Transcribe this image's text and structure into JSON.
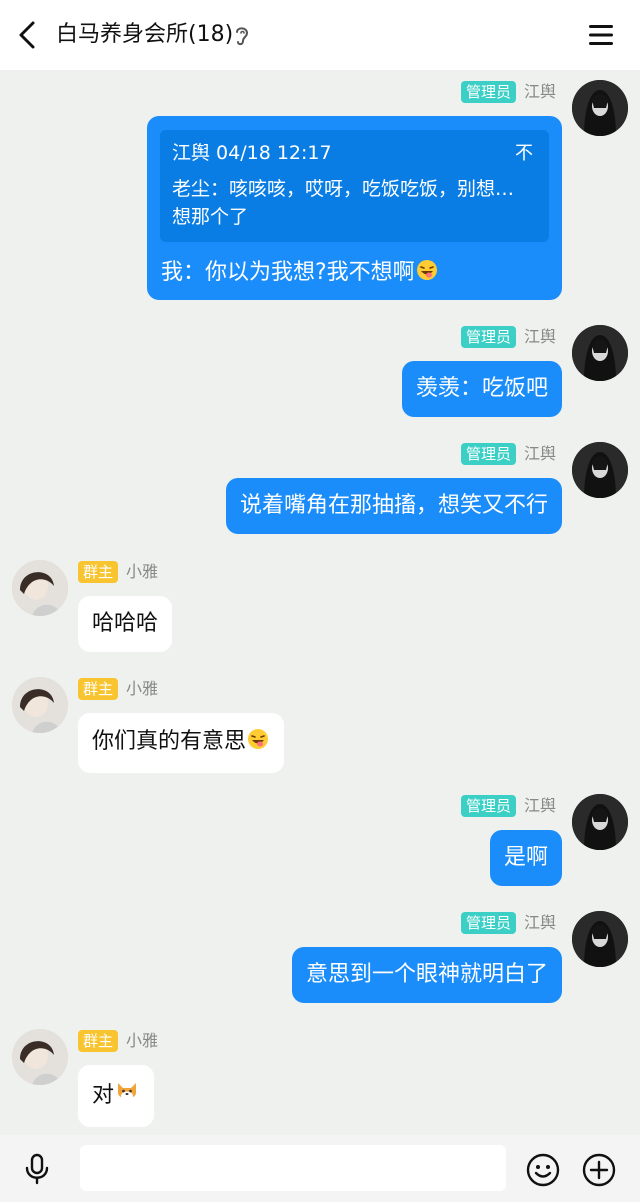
{
  "header": {
    "title": "白马养身会所(18)",
    "back_icon": "chevron-left-icon",
    "ear_icon": "ear-icon",
    "menu_icon": "hamburger-menu-icon"
  },
  "colors": {
    "outgoing_bubble": "#1a8dfa",
    "admin_badge": "#3ccfc6",
    "owner_badge": "#f8c531",
    "background": "#eef1ee"
  },
  "messages": [
    {
      "direction": "out",
      "role": "管理员",
      "sender": "江舆",
      "quote": {
        "header": "江舆 04/18 12:17",
        "action": "不",
        "text": "老尘：咳咳咳，哎呀，吃饭吃饭，别想…想那个了"
      },
      "text": "我：你以为我想?我不想啊",
      "emoji": "laughing-tongue-emoji"
    },
    {
      "direction": "out",
      "role": "管理员",
      "sender": "江舆",
      "text": "羡羡：吃饭吧"
    },
    {
      "direction": "out",
      "role": "管理员",
      "sender": "江舆",
      "text": "说着嘴角在那抽搐，想笑又不行"
    },
    {
      "direction": "in",
      "role": "群主",
      "sender": "小雅",
      "text": "哈哈哈"
    },
    {
      "direction": "in",
      "role": "群主",
      "sender": "小雅",
      "text": "你们真的有意思",
      "emoji": "laughing-tongue-emoji"
    },
    {
      "direction": "out",
      "role": "管理员",
      "sender": "江舆",
      "text": "是啊"
    },
    {
      "direction": "out",
      "role": "管理员",
      "sender": "江舆",
      "text": "意思到一个眼神就明白了"
    },
    {
      "direction": "in",
      "role": "群主",
      "sender": "小雅",
      "text": "对",
      "emoji": "shiba-dog-emoji"
    }
  ],
  "input_bar": {
    "mic_icon": "microphone-icon",
    "input_value": "",
    "emoji_icon": "smiley-face-icon",
    "plus_icon": "plus-circle-icon"
  }
}
